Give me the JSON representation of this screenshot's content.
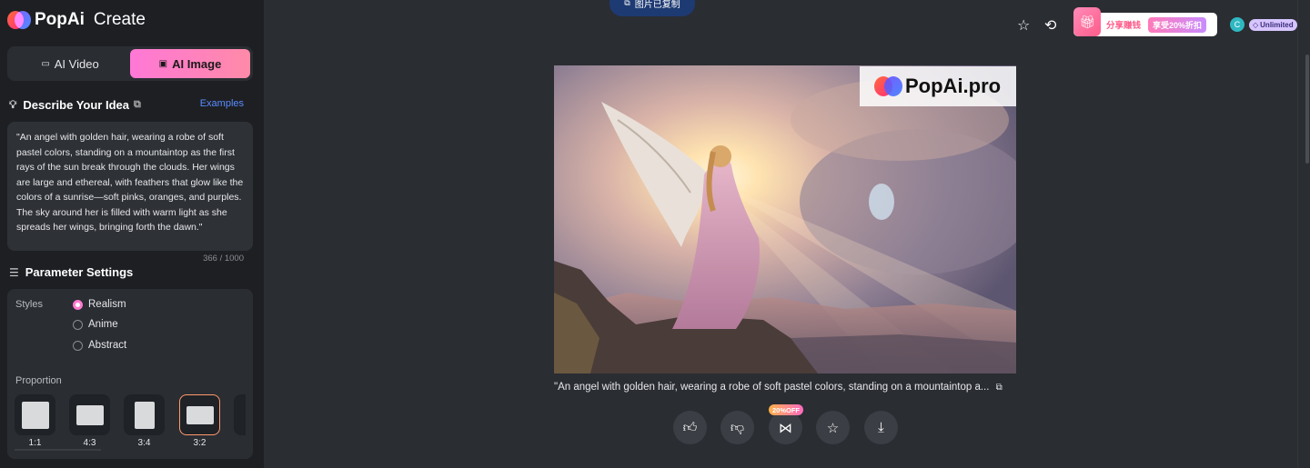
{
  "app": {
    "brand": "PopAi",
    "section": "Create"
  },
  "modes": [
    {
      "label": "AI Video",
      "active": false
    },
    {
      "label": "AI Image",
      "active": true
    }
  ],
  "describe": {
    "title": "Describe Your Idea",
    "examples_link": "Examples",
    "prompt": "\"An angel with golden hair, wearing a robe of soft pastel colors, standing on a mountaintop as the first rays of the sun break through the clouds. Her wings are large and ethereal, with feathers that glow like the colors of a sunrise—soft pinks, oranges, and purples. The sky around her is filled with warm light as she spreads her wings, bringing forth the dawn.\"",
    "char_count": "366 / 1000"
  },
  "parameters": {
    "title": "Parameter Settings",
    "styles_label": "Styles",
    "styles": [
      {
        "label": "Realism",
        "selected": true
      },
      {
        "label": "Anime",
        "selected": false
      },
      {
        "label": "Abstract",
        "selected": false
      }
    ],
    "proportion_label": "Proportion",
    "proportions": [
      {
        "label": "1:1",
        "selected": false
      },
      {
        "label": "4:3",
        "selected": false
      },
      {
        "label": "3:4",
        "selected": false
      },
      {
        "label": "3:2",
        "selected": true
      }
    ]
  },
  "toast": {
    "text": "图片已复制"
  },
  "header": {
    "promo_text": "分享赚钱",
    "promo_badge": "享受20%折扣",
    "avatar_initial": "C",
    "plan": "Unlimited"
  },
  "result": {
    "watermark": "PopAi.pro",
    "caption": "\"An angel with golden hair, wearing a robe of soft pastel colors, standing on a mountaintop a...",
    "share_badge": "20%OFF"
  },
  "colors": {
    "accent_pink": "#ff78d6",
    "link_blue": "#5a8cff",
    "background": "#2a2d32",
    "sidebar": "#1d1f23"
  }
}
